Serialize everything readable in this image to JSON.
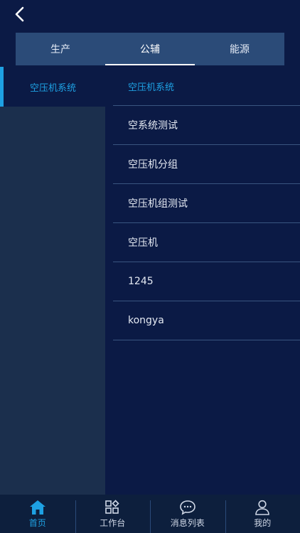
{
  "header": {
    "back_icon": "chevron-left-icon"
  },
  "tabs": [
    {
      "label": "生产",
      "active": false
    },
    {
      "label": "公辅",
      "active": true
    },
    {
      "label": "能源",
      "active": false
    }
  ],
  "left_menu": {
    "items": [
      {
        "label": "空压机系统"
      }
    ]
  },
  "right_list": {
    "items": [
      {
        "label": "空压机系统"
      },
      {
        "label": "空系统测试"
      },
      {
        "label": "空压机分组"
      },
      {
        "label": "空压机组测试"
      },
      {
        "label": "空压机"
      },
      {
        "label": "1245"
      },
      {
        "label": "kongya"
      }
    ]
  },
  "bottom_nav": {
    "items": [
      {
        "label": "首页",
        "icon": "home-icon"
      },
      {
        "label": "工作台",
        "icon": "workbench-icon"
      },
      {
        "label": "消息列表",
        "icon": "message-icon"
      },
      {
        "label": "我的",
        "icon": "user-icon"
      }
    ]
  },
  "colors": {
    "background": "#0b1a45",
    "tab_bar": "#2b4b78",
    "accent": "#1ea1e3",
    "left_pane": "#1b2f4d",
    "nav_bar": "#0d1f3d"
  }
}
